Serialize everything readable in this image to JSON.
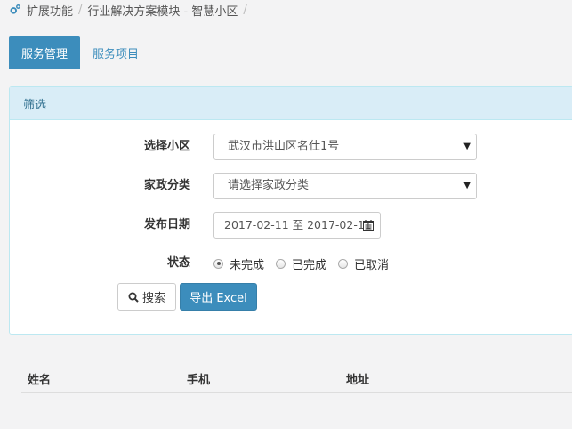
{
  "breadcrumb": {
    "items": [
      "扩展功能",
      "行业解决方案模块 - 智慧小区"
    ],
    "separator": "/"
  },
  "tabs": [
    {
      "label": "服务管理",
      "active": true
    },
    {
      "label": "服务项目",
      "active": false
    }
  ],
  "filter": {
    "heading": "筛选",
    "community": {
      "label": "选择小区",
      "value": "武汉市洪山区名仕1号"
    },
    "category": {
      "label": "家政分类",
      "value": "请选择家政分类"
    },
    "date": {
      "label": "发布日期",
      "value": "2017-02-11 至 2017-02-11"
    },
    "status": {
      "label": "状态",
      "options": [
        {
          "label": "未完成",
          "checked": true
        },
        {
          "label": "已完成",
          "checked": false
        },
        {
          "label": "已取消",
          "checked": false
        }
      ]
    },
    "search_label": "搜索",
    "export_label": "导出 Excel"
  },
  "table": {
    "columns": [
      "姓名",
      "手机",
      "地址"
    ]
  },
  "colors": {
    "primary": "#3c8dbc",
    "panel_heading": "#d9edf7",
    "background": "#f3f3f4"
  }
}
